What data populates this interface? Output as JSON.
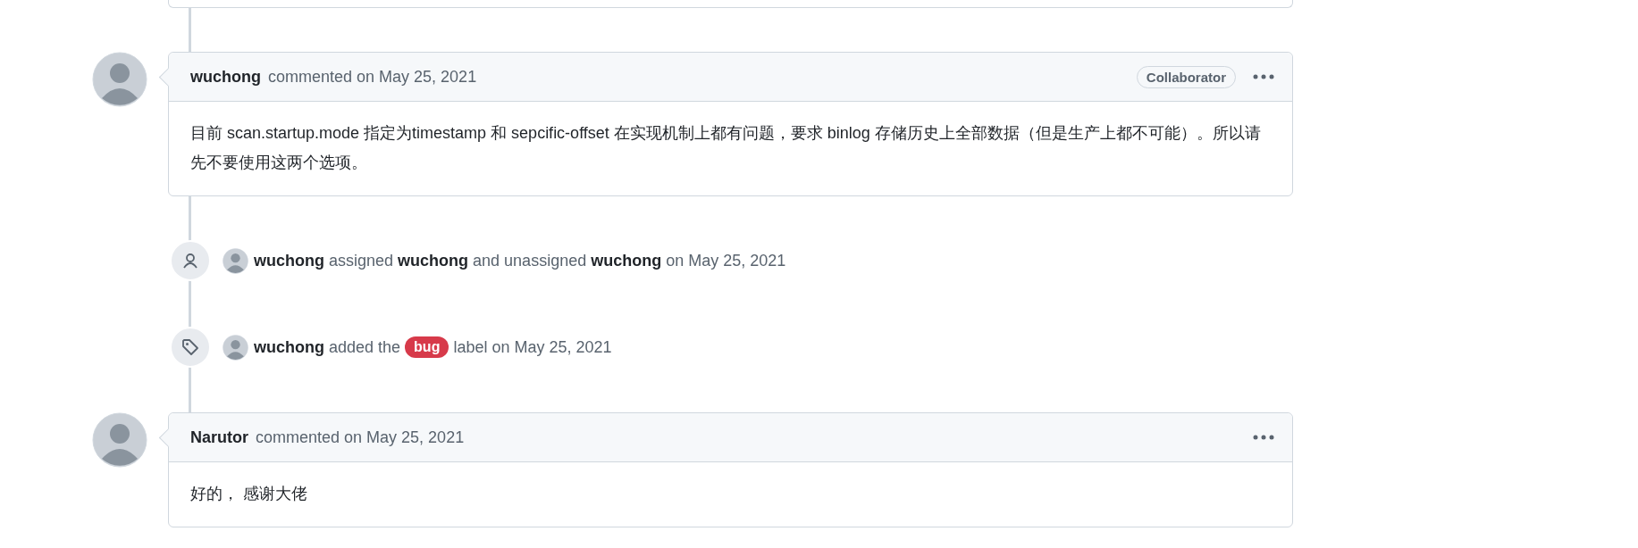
{
  "timeline": [
    {
      "kind": "comment",
      "author": "wuchong",
      "action": "commented on May 25, 2021",
      "badge": "Collaborator",
      "body": "目前 scan.startup.mode 指定为timestamp 和 sepcific-offset 在实现机制上都有问题，要求 binlog 存储历史上全部数据（但是生产上都不可能）。所以请先不要使用这两个选项。"
    },
    {
      "kind": "assigned",
      "actor": "wuchong",
      "text": "assigned **wuchong** and unassigned **wuchong** on May 25, 2021"
    },
    {
      "kind": "labeled",
      "actor": "wuchong",
      "before": "added the",
      "label": {
        "text": "bug",
        "color": "#d73a4a"
      },
      "after": "label on May 25, 2021"
    },
    {
      "kind": "comment",
      "author": "Narutor",
      "action": "commented on May 25, 2021",
      "body": "好的， 感谢大佬"
    }
  ]
}
